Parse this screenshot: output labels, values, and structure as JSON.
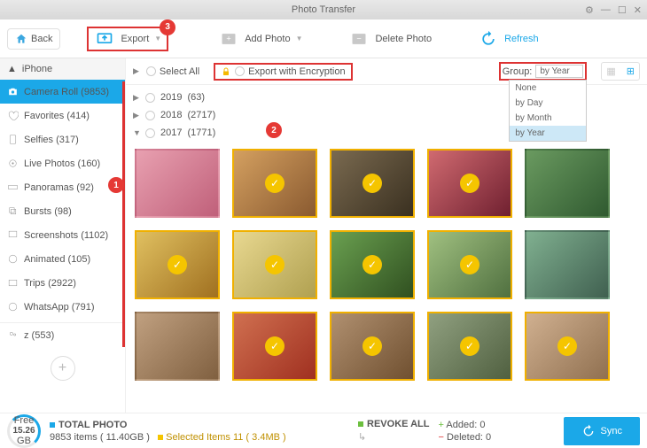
{
  "window": {
    "title": "Photo Transfer"
  },
  "toolbar": {
    "back": "Back",
    "export": "Export",
    "add": "Add Photo",
    "delete": "Delete Photo",
    "refresh": "Refresh"
  },
  "sidebar": {
    "device": "iPhone",
    "albums": [
      {
        "label": "Camera Roll (9853)",
        "icon": "camera"
      },
      {
        "label": "Favorites (414)",
        "icon": "heart"
      },
      {
        "label": "Selfies (317)",
        "icon": "selfie"
      },
      {
        "label": "Live Photos (160)",
        "icon": "live"
      },
      {
        "label": "Panoramas (92)",
        "icon": "pano"
      },
      {
        "label": "Bursts (98)",
        "icon": "burst"
      },
      {
        "label": "Screenshots (1102)",
        "icon": "screen"
      },
      {
        "label": "Animated (105)",
        "icon": "anim"
      },
      {
        "label": "Trips (2922)",
        "icon": "trip"
      },
      {
        "label": "WhatsApp (791)",
        "icon": "wa"
      }
    ],
    "shared": "z (553)"
  },
  "options": {
    "select_all": "Select All",
    "encrypt": "Export with Encryption",
    "group_label": "Group:",
    "group_value": "by Year",
    "group_opts": [
      "None",
      "by Day",
      "by Month",
      "by Year"
    ]
  },
  "years": [
    {
      "y": "2019",
      "c": "(63)",
      "open": false
    },
    {
      "y": "2018",
      "c": "(2717)",
      "open": false
    },
    {
      "y": "2017",
      "c": "(1771)",
      "open": true
    }
  ],
  "footer": {
    "free_val": "15.26",
    "free_unit": "GB",
    "free_lbl": "Free",
    "total_lbl": "TOTAL PHOTO",
    "total_txt": "9853 items ( 11.40GB )",
    "sel_txt": "Selected Items 11 ( 3.4MB )",
    "revoke": "REVOKE ALL",
    "added": "Added: 0",
    "deleted": "Deleted: 0",
    "sync": "Sync"
  },
  "badges": {
    "b1": "1",
    "b2": "2",
    "b3": "3"
  }
}
